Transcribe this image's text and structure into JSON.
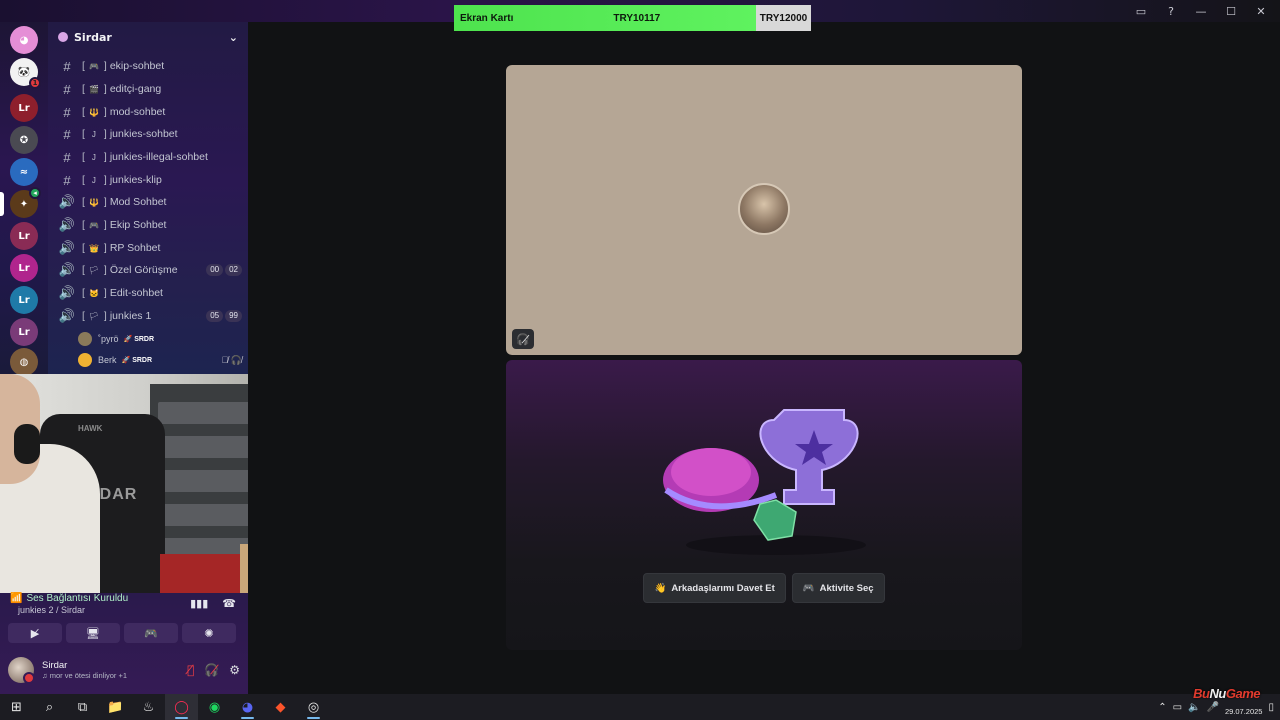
{
  "ticker": {
    "label": "Ekran Kartı",
    "value": "TRY10117",
    "target": "TRY12000"
  },
  "server": {
    "name": "Sirdar"
  },
  "channels": [
    {
      "type": "text",
      "tag": "🎮",
      "name": "ekip-sohbet"
    },
    {
      "type": "text",
      "tag": "🎬",
      "name": "editçi-gang"
    },
    {
      "type": "text",
      "tag": "🔱",
      "name": "mod-sohbet"
    },
    {
      "type": "text",
      "tag": "J",
      "name": "junkies-sohbet"
    },
    {
      "type": "text",
      "tag": "J",
      "name": "junkies-illegal-sohbet"
    },
    {
      "type": "text",
      "tag": "J",
      "name": "junkies-klip"
    },
    {
      "type": "voice",
      "tag": "🔱",
      "name": "Mod Sohbet"
    },
    {
      "type": "voice",
      "tag": "🎮",
      "name": "Ekip Sohbet"
    },
    {
      "type": "voice",
      "tag": "👑",
      "name": "RP Sohbet"
    },
    {
      "type": "voice",
      "tag": "🏳",
      "name": "Özel Görüşme",
      "counts": [
        "00",
        "02"
      ]
    },
    {
      "type": "voice",
      "tag": "🐱",
      "name": "Edit-sohbet"
    },
    {
      "type": "voice",
      "tag": "🏳",
      "name": "junkies 1",
      "counts": [
        "05",
        "99"
      ]
    }
  ],
  "members": [
    {
      "name": "˚pyrö",
      "role": "SRDR"
    },
    {
      "name": "Berk",
      "role": "SRDR"
    }
  ],
  "voice": {
    "status": "Ses Bağlantısı Kuruldu",
    "location": "junkies 2 / Sirdar"
  },
  "user": {
    "name": "Sirdar",
    "status": "mor ve ötesi dinliyor +1"
  },
  "tile_buttons": {
    "invite": "Arkadaşlarımı Davet Et",
    "activity": "Aktivite Seç"
  },
  "webcam": {
    "chair_text": "SiRDAR",
    "chair_logo": "HAWK"
  },
  "tray": {
    "date": "29.07.2025"
  },
  "watermark": {
    "a": "Bu",
    "b": "Nu",
    "c": "Game"
  },
  "colors": {
    "accent_green": "#4ee34e",
    "online_green": "#23a55a",
    "danger_red": "#f23f43",
    "brand": "#5865f2"
  }
}
